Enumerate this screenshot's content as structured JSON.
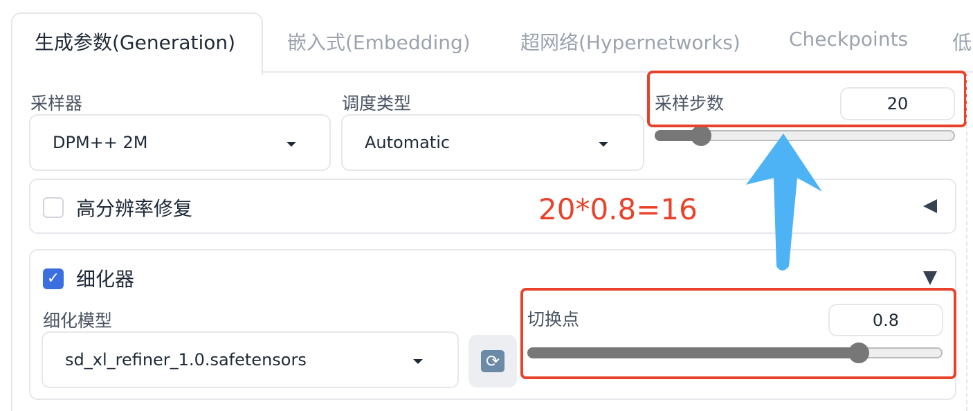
{
  "tabs": [
    {
      "label": "生成参数(Generation)",
      "active": true
    },
    {
      "label": "嵌入式(Embedding)"
    },
    {
      "label": "超网络(Hypernetworks)"
    },
    {
      "label": "Checkpoints"
    },
    {
      "label": "低"
    }
  ],
  "sampler": {
    "label": "采样器",
    "value": "DPM++ 2M"
  },
  "scheduler": {
    "label": "调度类型",
    "value": "Automatic"
  },
  "steps": {
    "label": "采样步数",
    "value": "20",
    "slider_fraction": 0.15
  },
  "hires": {
    "label": "高分辨率修复",
    "checked": false,
    "collapsed": true
  },
  "refiner": {
    "label": "细化器",
    "checked": true,
    "model_label": "细化模型",
    "model_value": "sd_xl_refiner_1.0.safetensors",
    "switch_label": "切换点",
    "switch_value": "0.8",
    "slider_fraction": 0.8
  },
  "annotation": {
    "text": "20*0.8=16",
    "color": "#e8432a",
    "arrow_color": "#4db3f5"
  }
}
